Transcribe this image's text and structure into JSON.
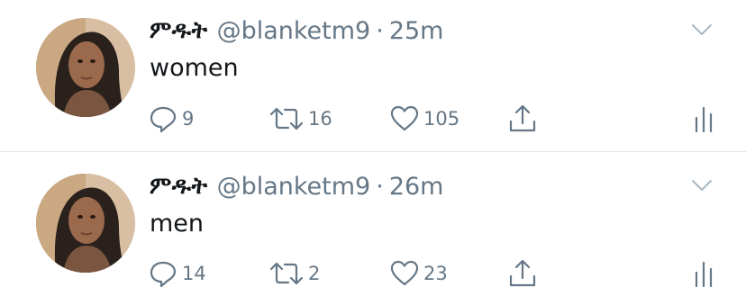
{
  "tweets": [
    {
      "name": "ምዱት",
      "handle": "@blanketm9",
      "separator": "·",
      "time": "25m",
      "text": "women",
      "replies": "9",
      "retweets": "16",
      "likes": "105"
    },
    {
      "name": "ምዱት",
      "handle": "@blanketm9",
      "separator": "·",
      "time": "26m",
      "text": "men",
      "replies": "14",
      "retweets": "2",
      "likes": "23"
    }
  ],
  "icons": {
    "reply": "reply-icon",
    "retweet": "retweet-icon",
    "like": "heart-icon",
    "share": "share-icon",
    "stats": "stats-icon",
    "menu": "chevron-down-icon"
  },
  "colors": {
    "icon": "#657786",
    "text": "#14171a",
    "divider": "#e1e8ed"
  }
}
